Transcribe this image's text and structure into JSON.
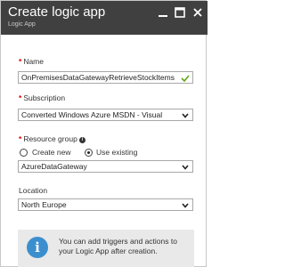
{
  "header": {
    "title": "Create logic app",
    "subtitle": "Logic App",
    "minimize_icon": "minimize-icon",
    "maximize_icon": "maximize-icon",
    "close_icon": "close-icon"
  },
  "name": {
    "label": "Name",
    "required_marker": "*",
    "value": "OnPremisesDataGatewayRetrieveStockItems",
    "valid_icon": "checkmark-icon"
  },
  "subscription": {
    "label": "Subscription",
    "required_marker": "*",
    "value": "Converted Windows Azure  MSDN - Visual"
  },
  "resource_group": {
    "label": "Resource group",
    "required_marker": "*",
    "info_icon": "info-icon",
    "option_create": "Create new",
    "option_existing": "Use existing",
    "selected": "Use existing",
    "value": "AzureDataGateway"
  },
  "location": {
    "label": "Location",
    "value": "North Europe"
  },
  "info": {
    "icon": "info-icon",
    "text": "You can add triggers and actions to your Logic App after creation."
  },
  "colors": {
    "header_bg": "#404040",
    "required": "#e00000",
    "valid_check": "#5ea314",
    "info_icon": "#3c8fce",
    "info_bg": "#e9e9e9"
  }
}
